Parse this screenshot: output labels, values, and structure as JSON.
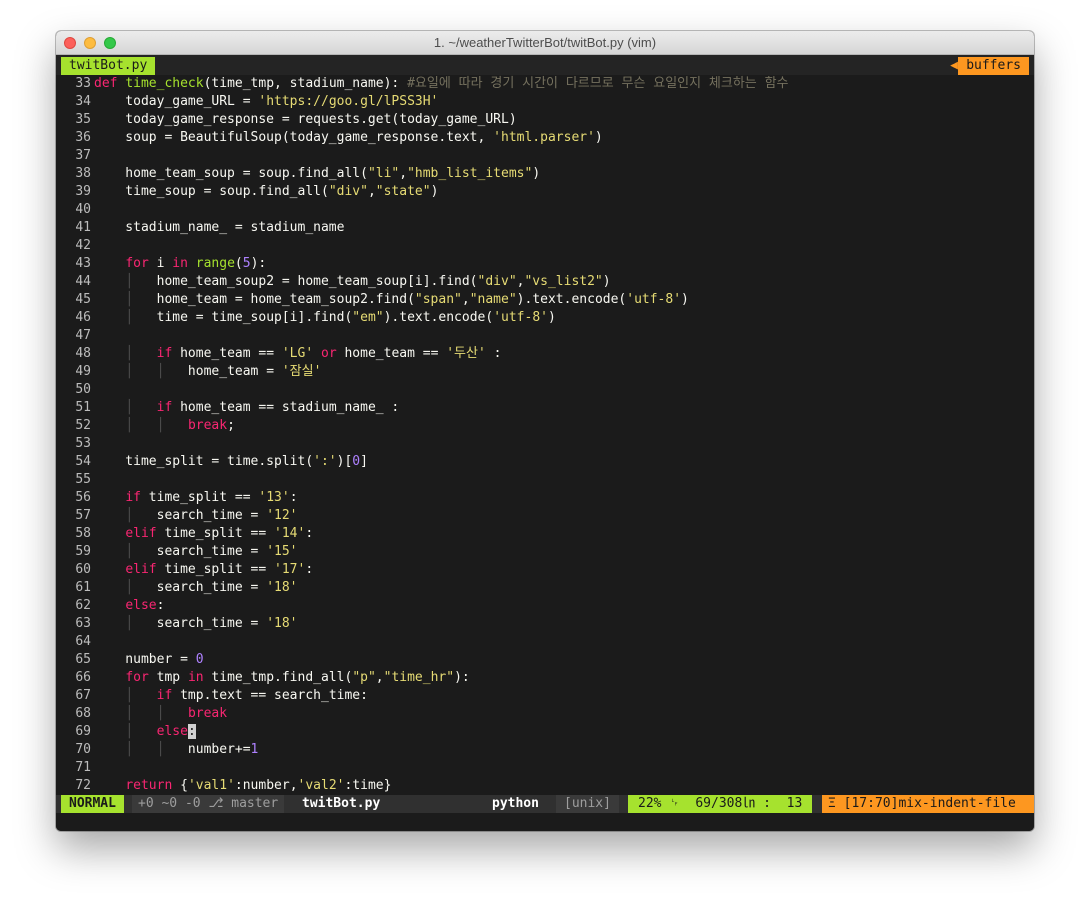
{
  "window": {
    "title": "1. ~/weatherTwitterBot/twitBot.py (vim)"
  },
  "tabline": {
    "active_tab": "twitBot.py",
    "buffers_label": "buffers"
  },
  "editor": {
    "lines": [
      {
        "n": "33",
        "segs": [
          [
            "kw",
            "def"
          ],
          [
            "",
            "␣"
          ],
          [
            "fn",
            "time_check"
          ],
          [
            "",
            "(time_tmp, stadium_name): "
          ],
          [
            "cm",
            "#요일에 따라 경기 시간이 다르므로 무슨 요일인지 체크하는 함수"
          ]
        ]
      },
      {
        "n": "34",
        "segs": [
          [
            "",
            "    today_game_URL = "
          ],
          [
            "st",
            "'https://goo.gl/lPSS3H'"
          ]
        ]
      },
      {
        "n": "35",
        "segs": [
          [
            "",
            "    today_game_response = requests.get(today_game_URL)"
          ]
        ]
      },
      {
        "n": "36",
        "segs": [
          [
            "",
            "    soup = BeautifulSoup(today_game_response.text, "
          ],
          [
            "st",
            "'html.parser'"
          ],
          [
            "",
            ")"
          ]
        ]
      },
      {
        "n": "37",
        "segs": []
      },
      {
        "n": "38",
        "segs": [
          [
            "",
            "    home_team_soup = soup.find_all("
          ],
          [
            "st",
            "\"li\""
          ],
          [
            "",
            ","
          ],
          [
            "st",
            "\"hmb_list_items\""
          ],
          [
            "",
            ")"
          ]
        ]
      },
      {
        "n": "39",
        "segs": [
          [
            "",
            "    time_soup = soup.find_all("
          ],
          [
            "st",
            "\"div\""
          ],
          [
            "",
            ","
          ],
          [
            "st",
            "\"state\""
          ],
          [
            "",
            ")"
          ]
        ]
      },
      {
        "n": "40",
        "segs": []
      },
      {
        "n": "41",
        "segs": [
          [
            "",
            "    stadium_name_ = stadium_name"
          ]
        ]
      },
      {
        "n": "42",
        "segs": []
      },
      {
        "n": "43",
        "segs": [
          [
            "",
            "    "
          ],
          [
            "kw",
            "for"
          ],
          [
            "",
            ""
          ],
          [
            "",
            "␣i "
          ],
          [
            "kw",
            "in"
          ],
          [
            "",
            "␣"
          ],
          [
            "bi",
            "range"
          ],
          [
            "",
            "("
          ],
          [
            "nm",
            "5"
          ],
          [
            "",
            "):"
          ]
        ]
      },
      {
        "n": "44",
        "segs": [
          [
            "",
            "    "
          ],
          [
            "guide",
            "│"
          ],
          [
            "",
            "   home_team_soup2 = home_team_soup[i].find("
          ],
          [
            "st",
            "\"div\""
          ],
          [
            "",
            ","
          ],
          [
            "st",
            "\"vs_list2\""
          ],
          [
            "",
            ")"
          ]
        ]
      },
      {
        "n": "45",
        "segs": [
          [
            "",
            "    "
          ],
          [
            "guide",
            "│"
          ],
          [
            "",
            "   home_team = home_team_soup2.find("
          ],
          [
            "st",
            "\"span\""
          ],
          [
            "",
            ","
          ],
          [
            "st",
            "\"name\""
          ],
          [
            "",
            ").text.encode("
          ],
          [
            "st",
            "'utf-8'"
          ],
          [
            "",
            ")"
          ]
        ]
      },
      {
        "n": "46",
        "segs": [
          [
            "",
            "    "
          ],
          [
            "guide",
            "│"
          ],
          [
            "",
            "   time = time_soup[i].find("
          ],
          [
            "st",
            "\"em\""
          ],
          [
            "",
            ").text.encode("
          ],
          [
            "st",
            "'utf-8'"
          ],
          [
            "",
            ")"
          ]
        ]
      },
      {
        "n": "47",
        "segs": []
      },
      {
        "n": "48",
        "segs": [
          [
            "",
            "    "
          ],
          [
            "guide",
            "│"
          ],
          [
            "",
            "   "
          ],
          [
            "kw",
            "if"
          ],
          [
            "",
            "␣home_team == "
          ],
          [
            "st",
            "'LG'"
          ],
          [
            "",
            "␣"
          ],
          [
            "kw",
            "or"
          ],
          [
            "",
            "␣home_team == "
          ],
          [
            "st",
            "'두산'"
          ],
          [
            "",
            "␣:"
          ]
        ]
      },
      {
        "n": "49",
        "segs": [
          [
            "",
            "    "
          ],
          [
            "guide",
            "│"
          ],
          [
            "",
            "   "
          ],
          [
            "guide",
            "│"
          ],
          [
            "",
            "   home_team = "
          ],
          [
            "st",
            "'잠실'"
          ]
        ]
      },
      {
        "n": "50",
        "segs": []
      },
      {
        "n": "51",
        "segs": [
          [
            "",
            "    "
          ],
          [
            "guide",
            "│"
          ],
          [
            "",
            "   "
          ],
          [
            "kw",
            "if"
          ],
          [
            "",
            "␣home_team == stadium_name_ :"
          ]
        ]
      },
      {
        "n": "52",
        "segs": [
          [
            "",
            "    "
          ],
          [
            "guide",
            "│"
          ],
          [
            "",
            "   "
          ],
          [
            "guide",
            "│"
          ],
          [
            "",
            "   "
          ],
          [
            "kw",
            "break"
          ],
          [
            "",
            ";"
          ]
        ]
      },
      {
        "n": "53",
        "segs": []
      },
      {
        "n": "54",
        "segs": [
          [
            "",
            "    time_split = time.split("
          ],
          [
            "st",
            "':'"
          ],
          [
            "",
            ")["
          ],
          [
            "nm",
            "0"
          ],
          [
            "",
            "]"
          ]
        ]
      },
      {
        "n": "55",
        "segs": []
      },
      {
        "n": "56",
        "segs": [
          [
            "",
            "    "
          ],
          [
            "kw",
            "if"
          ],
          [
            "",
            "␣time_split == "
          ],
          [
            "st",
            "'13'"
          ],
          [
            "",
            ":"
          ]
        ]
      },
      {
        "n": "57",
        "segs": [
          [
            "",
            "    "
          ],
          [
            "guide",
            "│"
          ],
          [
            "",
            "   search_time = "
          ],
          [
            "st",
            "'12'"
          ]
        ]
      },
      {
        "n": "58",
        "segs": [
          [
            "",
            "    "
          ],
          [
            "kw",
            "elif"
          ],
          [
            "",
            "␣time_split == "
          ],
          [
            "st",
            "'14'"
          ],
          [
            "",
            ":"
          ]
        ]
      },
      {
        "n": "59",
        "segs": [
          [
            "",
            "    "
          ],
          [
            "guide",
            "│"
          ],
          [
            "",
            "   search_time = "
          ],
          [
            "st",
            "'15'"
          ]
        ]
      },
      {
        "n": "60",
        "segs": [
          [
            "",
            "    "
          ],
          [
            "kw",
            "elif"
          ],
          [
            "",
            "␣time_split == "
          ],
          [
            "st",
            "'17'"
          ],
          [
            "",
            ":"
          ]
        ]
      },
      {
        "n": "61",
        "segs": [
          [
            "",
            "    "
          ],
          [
            "guide",
            "│"
          ],
          [
            "",
            "   search_time = "
          ],
          [
            "st",
            "'18'"
          ]
        ]
      },
      {
        "n": "62",
        "segs": [
          [
            "",
            "    "
          ],
          [
            "kw",
            "else"
          ],
          [
            "",
            ":"
          ]
        ]
      },
      {
        "n": "63",
        "segs": [
          [
            "",
            "    "
          ],
          [
            "guide",
            "│"
          ],
          [
            "",
            "   search_time = "
          ],
          [
            "st",
            "'18'"
          ]
        ]
      },
      {
        "n": "64",
        "segs": []
      },
      {
        "n": "65",
        "segs": [
          [
            "",
            "    number = "
          ],
          [
            "nm",
            "0"
          ]
        ]
      },
      {
        "n": "66",
        "segs": [
          [
            "",
            "    "
          ],
          [
            "kw",
            "for"
          ],
          [
            "",
            "␣tmp "
          ],
          [
            "kw",
            "in"
          ],
          [
            "",
            "␣time_tmp.find_all("
          ],
          [
            "st",
            "\"p\""
          ],
          [
            "",
            ","
          ],
          [
            "st",
            "\"time_hr\""
          ],
          [
            "",
            "):"
          ]
        ]
      },
      {
        "n": "67",
        "segs": [
          [
            "",
            "    "
          ],
          [
            "guide",
            "│"
          ],
          [
            "",
            "   "
          ],
          [
            "kw",
            "if"
          ],
          [
            "",
            "␣tmp.text == search_time:"
          ]
        ]
      },
      {
        "n": "68",
        "segs": [
          [
            "",
            "    "
          ],
          [
            "guide",
            "│"
          ],
          [
            "",
            "   "
          ],
          [
            "guide",
            "│"
          ],
          [
            "",
            "   "
          ],
          [
            "kw",
            "break"
          ]
        ]
      },
      {
        "n": "69",
        "segs": [
          [
            "",
            "    "
          ],
          [
            "guide",
            "│"
          ],
          [
            "",
            "   "
          ],
          [
            "kw",
            "else"
          ],
          [
            "cur",
            ":"
          ]
        ]
      },
      {
        "n": "70",
        "segs": [
          [
            "",
            "    "
          ],
          [
            "guide",
            "│"
          ],
          [
            "",
            "   "
          ],
          [
            "guide",
            "│"
          ],
          [
            "",
            "   number+="
          ],
          [
            "nm",
            "1"
          ]
        ]
      },
      {
        "n": "71",
        "segs": []
      },
      {
        "n": "72",
        "segs": [
          [
            "",
            "    "
          ],
          [
            "kw",
            "return"
          ],
          [
            "",
            "␣{"
          ],
          [
            "st",
            "'val1'"
          ],
          [
            "",
            ":number,"
          ],
          [
            "st",
            "'val2'"
          ],
          [
            "",
            ":time}"
          ]
        ]
      }
    ]
  },
  "statusline": {
    "mode": "NORMAL",
    "git": "+0 ~0 -0 ⎇ master",
    "filename": "twitBot.py",
    "filetype": "python",
    "fileformat": "[unix]",
    "position": "22% ␊  69/308㏑ :  13",
    "warning": "Ξ [17:70]mix-indent-file"
  },
  "colors": {
    "keyword": "#f92672",
    "function": "#a6e22e",
    "string": "#e6db74",
    "number": "#ae81ff",
    "comment": "#75715e",
    "mode_bg": "#a6e22e",
    "warning_bg": "#fd9720"
  }
}
